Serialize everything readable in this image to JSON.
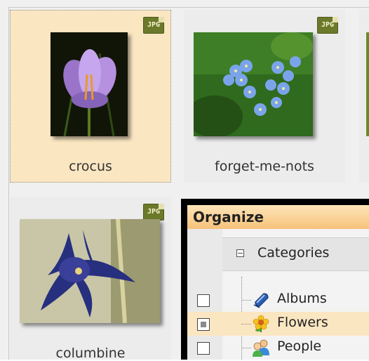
{
  "gallery": {
    "items": [
      {
        "label": "crocus",
        "badge": "JPG",
        "selected": true
      },
      {
        "label": "forget-me-nots",
        "badge": "JPG",
        "selected": false
      },
      {
        "label": "columbine",
        "badge": "JPG",
        "selected": false
      }
    ]
  },
  "organize": {
    "title": "Organize",
    "categories_label": "Categories",
    "collapse_symbol": "−",
    "items": [
      {
        "label": "Albums",
        "icon": "albums-icon",
        "state": "unchecked"
      },
      {
        "label": "Flowers",
        "icon": "flower-icon",
        "state": "partial",
        "selected": true
      },
      {
        "label": "People",
        "icon": "people-icon",
        "state": "unchecked"
      }
    ]
  },
  "colors": {
    "selection": "#fbe6c2",
    "title_bar": "#f7c27a",
    "badge": "#6b7a2a"
  }
}
